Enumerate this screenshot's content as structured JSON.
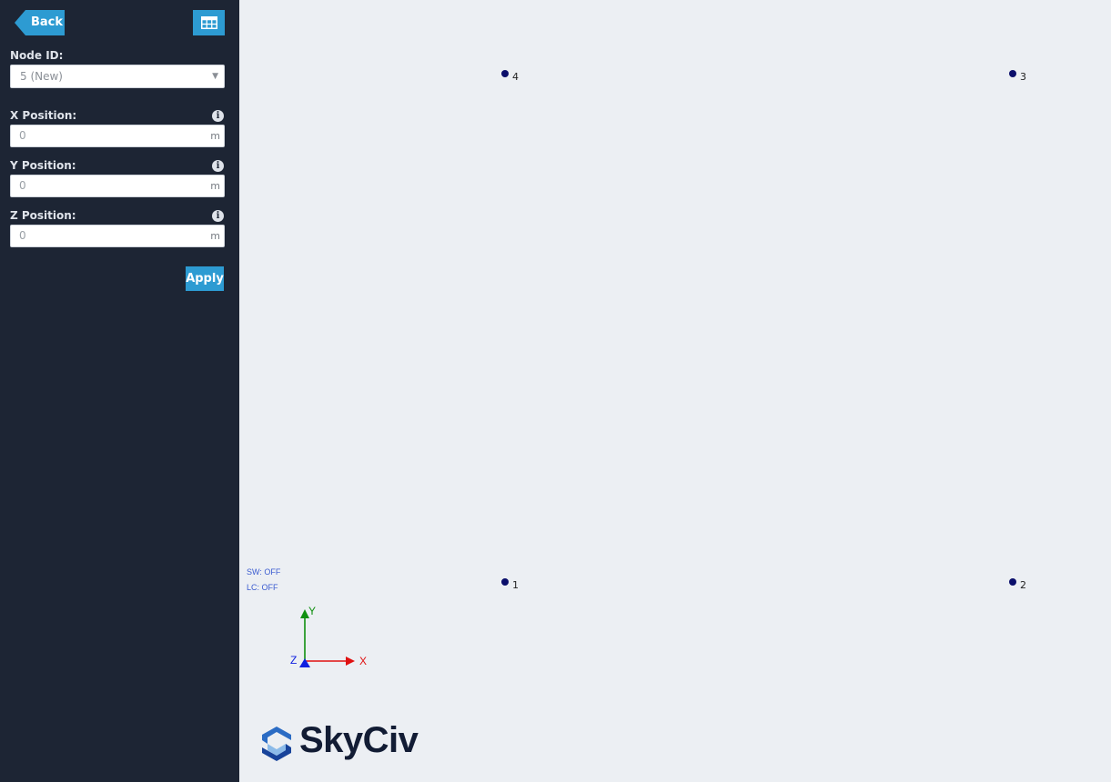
{
  "sidebar": {
    "back_label": "Back",
    "node_id_label": "Node ID:",
    "node_id_value": "5 (New)",
    "x_label": "X Position:",
    "x_value": "0",
    "y_label": "Y Position:",
    "y_value": "0",
    "z_label": "Z Position:",
    "z_value": "0",
    "unit": "m",
    "apply_label": "Apply",
    "info_glyph": "i"
  },
  "canvas": {
    "nodes": [
      {
        "id": "4"
      },
      {
        "id": "3"
      },
      {
        "id": "1"
      },
      {
        "id": "2"
      }
    ],
    "sw_status": "SW: OFF",
    "lc_status": "LC: OFF",
    "axis_y": "Y",
    "axis_x": "X",
    "axis_z": "Z",
    "colors": {
      "x_axis": "#e01010",
      "y_axis": "#109010",
      "z_axis": "#1020e0",
      "node": "#0b0f6b"
    }
  },
  "brand": {
    "logo_text": "SkyCiv"
  },
  "icons": {
    "table": "table-grid-icon",
    "info": "info-icon",
    "caret": "chevron-down-icon",
    "logo": "skyciv-logo-icon"
  }
}
